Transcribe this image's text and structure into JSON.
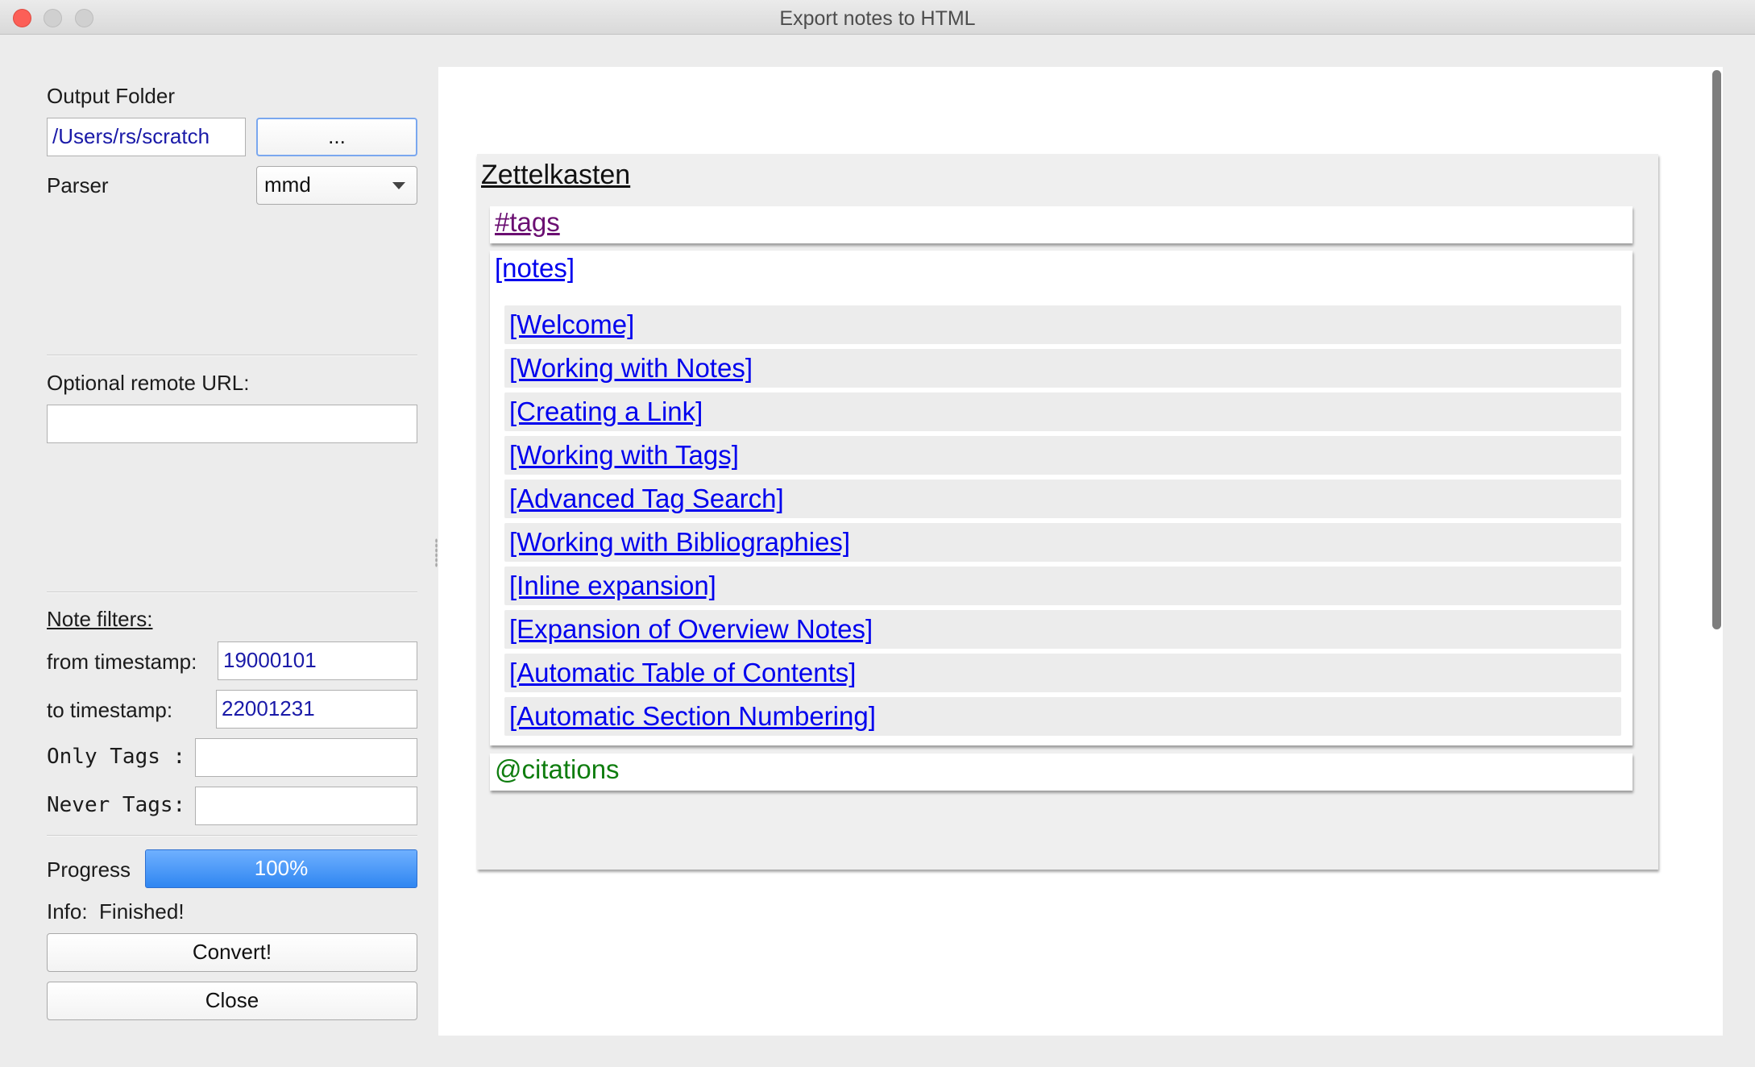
{
  "window": {
    "title": "Export notes to HTML"
  },
  "form": {
    "output_folder_label": "Output Folder",
    "output_folder_value": "/Users/rs/scratch",
    "browse_label": "...",
    "parser_label": "Parser",
    "parser_value": "mmd",
    "remote_url_label": "Optional remote URL:",
    "remote_url_value": "",
    "note_filters_label": "Note filters:",
    "from_label": "from timestamp:",
    "from_value": "19000101",
    "to_label": "to timestamp:",
    "to_value": "22001231",
    "only_tags_label": "Only Tags :",
    "only_tags_value": "",
    "never_tags_label": "Never Tags:",
    "never_tags_value": "",
    "progress_label": "Progress",
    "progress_value": 100,
    "progress_text": "100%",
    "info_label": "Info:",
    "info_value": "Finished!",
    "convert_label": "Convert!",
    "close_label": "Close"
  },
  "preview": {
    "title": "Zettelkasten",
    "tags_link": "#tags",
    "notes_link": "[notes]",
    "notes": [
      "[Welcome]",
      "[Working with Notes]",
      "[Creating a Link]",
      "[Working with Tags]",
      "[Advanced Tag Search]",
      "[Working with Bibliographies]",
      "[Inline expansion]",
      "[Expansion of Overview Notes]",
      "[Automatic Table of Contents]",
      "[Automatic Section Numbering]"
    ],
    "citations_link": "@citations"
  },
  "colors": {
    "link": "#0000ee",
    "tag_link": "#6b0f72",
    "citation_link": "#0f7d0f",
    "progress": "#2f86f1",
    "close_button": "#fc5f57"
  }
}
